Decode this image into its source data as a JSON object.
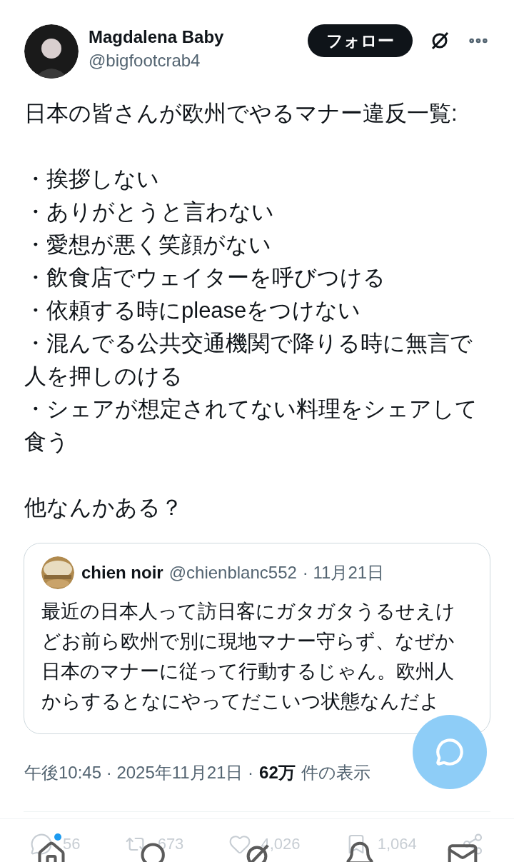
{
  "author": {
    "name": "Magdalena Baby",
    "handle": "@bigfootcrab4"
  },
  "follow_button": {
    "label": "フォロー"
  },
  "body": {
    "heading": "日本の皆さんが欧州でやるマナー違反一覧:",
    "items": [
      "・挨拶しない",
      "・ありがとうと言わない",
      "・愛想が悪く笑顔がない",
      "・飲食店でウェイターを呼びつける",
      "・依頼する時にpleaseをつけない",
      "・混んでる公共交通機関で降りる時に無言で人を押しのける",
      "・シェアが想定されてない料理をシェアして食う"
    ],
    "closing": "他なんかある？"
  },
  "quote": {
    "name": "chien noir",
    "handle": "@chienblanc552",
    "date": "· 11月21日",
    "text": "最近の日本人って訪日客にガタガタうるせえけどお前ら欧州で別に現地マナー守らず、なぜか日本のマナーに従って行動するじゃん。欧州人からするとなにやってだこいつ状態なんだよ"
  },
  "meta": {
    "time": "午後10:45 · 2025年11月21日 ·",
    "views": "62万",
    "views_label": "件の表示"
  },
  "actions": [
    {
      "kind": "reply",
      "count": "56"
    },
    {
      "kind": "repost",
      "count": "673"
    },
    {
      "kind": "like",
      "count": "4,026"
    },
    {
      "kind": "bookmark",
      "count": "1,064"
    },
    {
      "kind": "share"
    }
  ],
  "nav": [
    {
      "kind": "home",
      "badge": true
    },
    {
      "kind": "search",
      "badge": false
    },
    {
      "kind": "grok",
      "badge": false
    },
    {
      "kind": "notifications",
      "badge": false
    },
    {
      "kind": "messages",
      "badge": false
    }
  ]
}
